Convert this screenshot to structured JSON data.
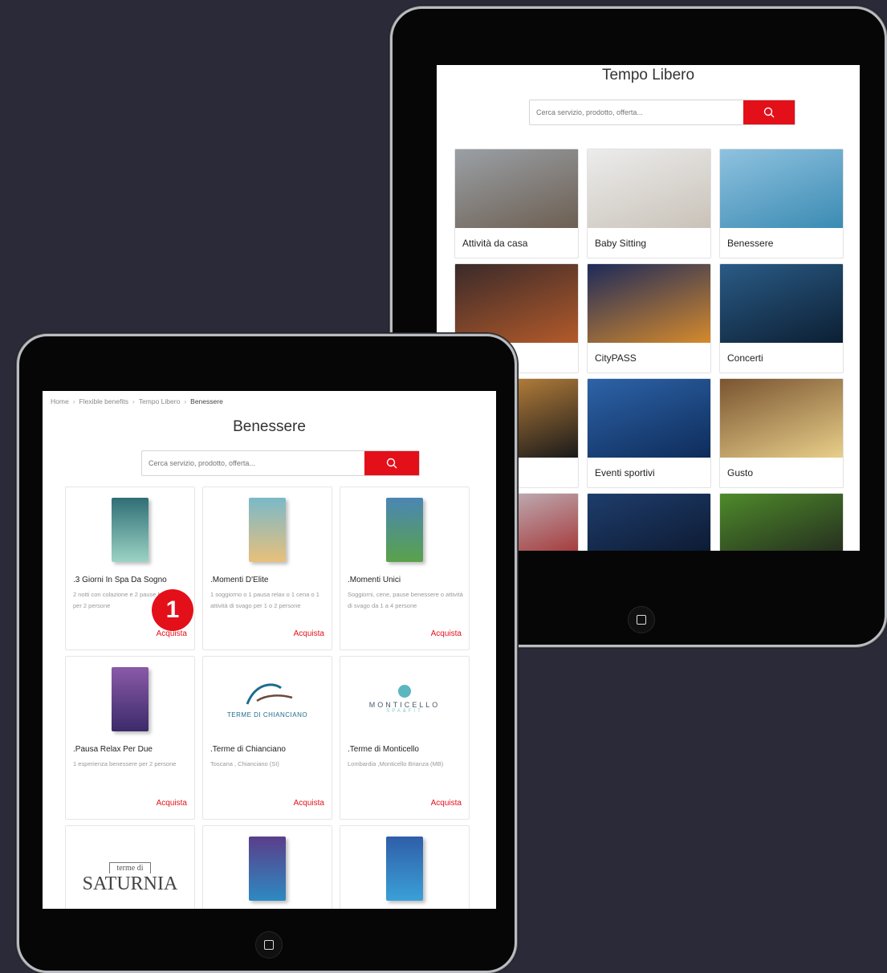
{
  "back_tablet": {
    "title": "Tempo Libero",
    "search_placeholder": "Cerca servizio, prodotto, offerta...",
    "categories": [
      {
        "label": "Attività da casa",
        "colors": [
          "#9aa0a6",
          "#6d5f52"
        ]
      },
      {
        "label": "Baby Sitting",
        "colors": [
          "#ececec",
          "#c9c2b8"
        ]
      },
      {
        "label": "Benessere",
        "colors": [
          "#8fc2df",
          "#3b8bb3"
        ]
      },
      {
        "label": "",
        "colors": [
          "#3a2a2a",
          "#b35a2a"
        ]
      },
      {
        "label": "CityPASS",
        "colors": [
          "#1d2a5a",
          "#d58a2c"
        ]
      },
      {
        "label": "Concerti",
        "colors": [
          "#2a5b86",
          "#0c1f33"
        ]
      },
      {
        "label": "",
        "colors": [
          "#d29040",
          "#1a1a1a"
        ]
      },
      {
        "label": "Eventi sportivi",
        "colors": [
          "#2d63a8",
          "#0e2c5a"
        ]
      },
      {
        "label": "Gusto",
        "colors": [
          "#7a5430",
          "#e8cf8a"
        ]
      },
      {
        "label": "",
        "colors": [
          "#c2c7cf",
          "#a02020"
        ]
      },
      {
        "label": "",
        "colors": [
          "#1e3d6c",
          "#0a1428"
        ]
      },
      {
        "label": "",
        "colors": [
          "#4e8a2a",
          "#1d1d1d"
        ]
      }
    ]
  },
  "front_tablet": {
    "breadcrumb": [
      "Home",
      "Flexible benefits",
      "Tempo Libero",
      "Benessere"
    ],
    "title": "Benessere",
    "search_placeholder": "Cerca servizio, prodotto, offerta...",
    "buy_label": "Acquista",
    "step_badge": "1",
    "products": [
      {
        "name": ".3 Giorni In Spa Da Sogno",
        "desc": "2 notti con colazione e 2 pause benessere per 2 persone",
        "buy": "Acquista",
        "colors": [
          "#2f6e76",
          "#9bd3c4"
        ]
      },
      {
        "name": ".Momenti D'Elite",
        "desc": "1 soggiorno o 1 pausa relax o 1 cena o 1 attività di svago per 1 o 2 persone",
        "buy": "Acquista",
        "colors": [
          "#7ab9c9",
          "#e8c07a"
        ]
      },
      {
        "name": ".Momenti Unici",
        "desc": "Soggiorni, cene, pause benessere o attività di svago da 1 a 4 persone",
        "buy": "Acquista",
        "colors": [
          "#4a86b4",
          "#5aa24a"
        ]
      },
      {
        "name": ".Pausa Relax Per Due",
        "desc": "1 esperienza benessere per 2 persone",
        "buy": "Acquista",
        "colors": [
          "#8a5aa8",
          "#3b2a6a"
        ]
      },
      {
        "name": ".Terme di Chianciano",
        "desc": "Toscana , Chianciano (SI)",
        "buy": "Acquista",
        "logo_text": "TERME DI CHIANCIANO"
      },
      {
        "name": ".Terme di Monticello",
        "desc": "Lombardia ,Monticello Brianza (MB)",
        "buy": "Acquista",
        "logo_text": "MONTICELLO",
        "logo_sub": "SPA&FIT"
      },
      {
        "name": "",
        "desc": "",
        "buy": "",
        "logo_top": "terme di",
        "logo_text": "SATURNIA"
      },
      {
        "name": "",
        "desc": "",
        "buy": "",
        "colors": [
          "#5a3e8a",
          "#2d8ac2"
        ]
      },
      {
        "name": "",
        "desc": "",
        "buy": "",
        "colors": [
          "#2f5ea8",
          "#3aa0d8"
        ]
      }
    ]
  },
  "colors": {
    "accent": "#e3101a",
    "background": "#2a2a39"
  }
}
